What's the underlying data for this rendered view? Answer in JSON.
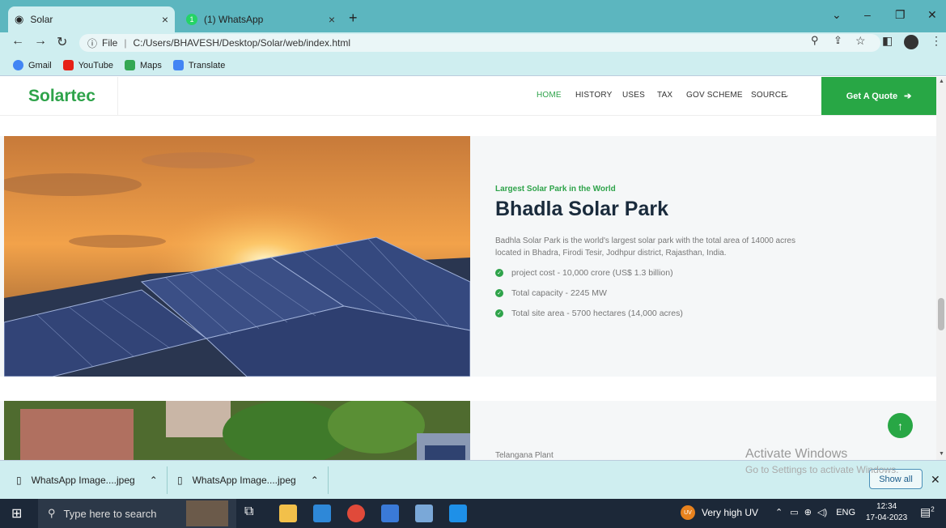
{
  "browser": {
    "tabs": [
      {
        "title": "Solar",
        "close": "×"
      },
      {
        "title": "(1) WhatsApp",
        "badge": "1",
        "close": "×"
      }
    ],
    "new_tab": "+",
    "address": {
      "scheme_label": "File",
      "url": "C:/Users/BHAVESH/Desktop/Solar/web/index.html"
    },
    "bookmarks": [
      {
        "label": "Gmail",
        "color": "#4285f4"
      },
      {
        "label": "YouTube",
        "color": "#e62117"
      },
      {
        "label": "Maps",
        "color": "#34a853"
      },
      {
        "label": "Translate",
        "color": "#4285f4"
      }
    ]
  },
  "site": {
    "logo": "Solartec",
    "menu": [
      "HOME",
      "HISTORY",
      "USES",
      "TAX",
      "GOV SCHEME",
      "SOURCE"
    ],
    "active_menu": "HOME",
    "quote_button": "Get A Quote",
    "accent_color": "#28a745"
  },
  "section1": {
    "subtitle": "Largest Solar Park in the World",
    "heading": "Bhadla Solar Park",
    "description": "Badhla Solar Park is the world's largest solar park with the total area of 14000 acres located in Bhadra, Firodi Tesir, Jodhpur district, Rajasthan, India.",
    "features": [
      "project cost - 10,000 crore (US$ 1.3 billion)",
      "Total capacity - 2245 MW",
      "Total site area - 5700 hectares (14,000 acres)"
    ]
  },
  "section2": {
    "label": "Telangana Plant"
  },
  "activation": {
    "title": "Activate Windows",
    "subtitle": "Go to Settings to activate Windows."
  },
  "downloads": {
    "items": [
      "WhatsApp Image....jpeg",
      "WhatsApp Image....jpeg"
    ],
    "show_all": "Show all"
  },
  "taskbar": {
    "search_placeholder": "Type here to search",
    "weather_badge": "UV",
    "weather": "Very high UV",
    "language": "ENG",
    "time": "12:34",
    "date": "17-04-2023",
    "notification_count": "2"
  }
}
